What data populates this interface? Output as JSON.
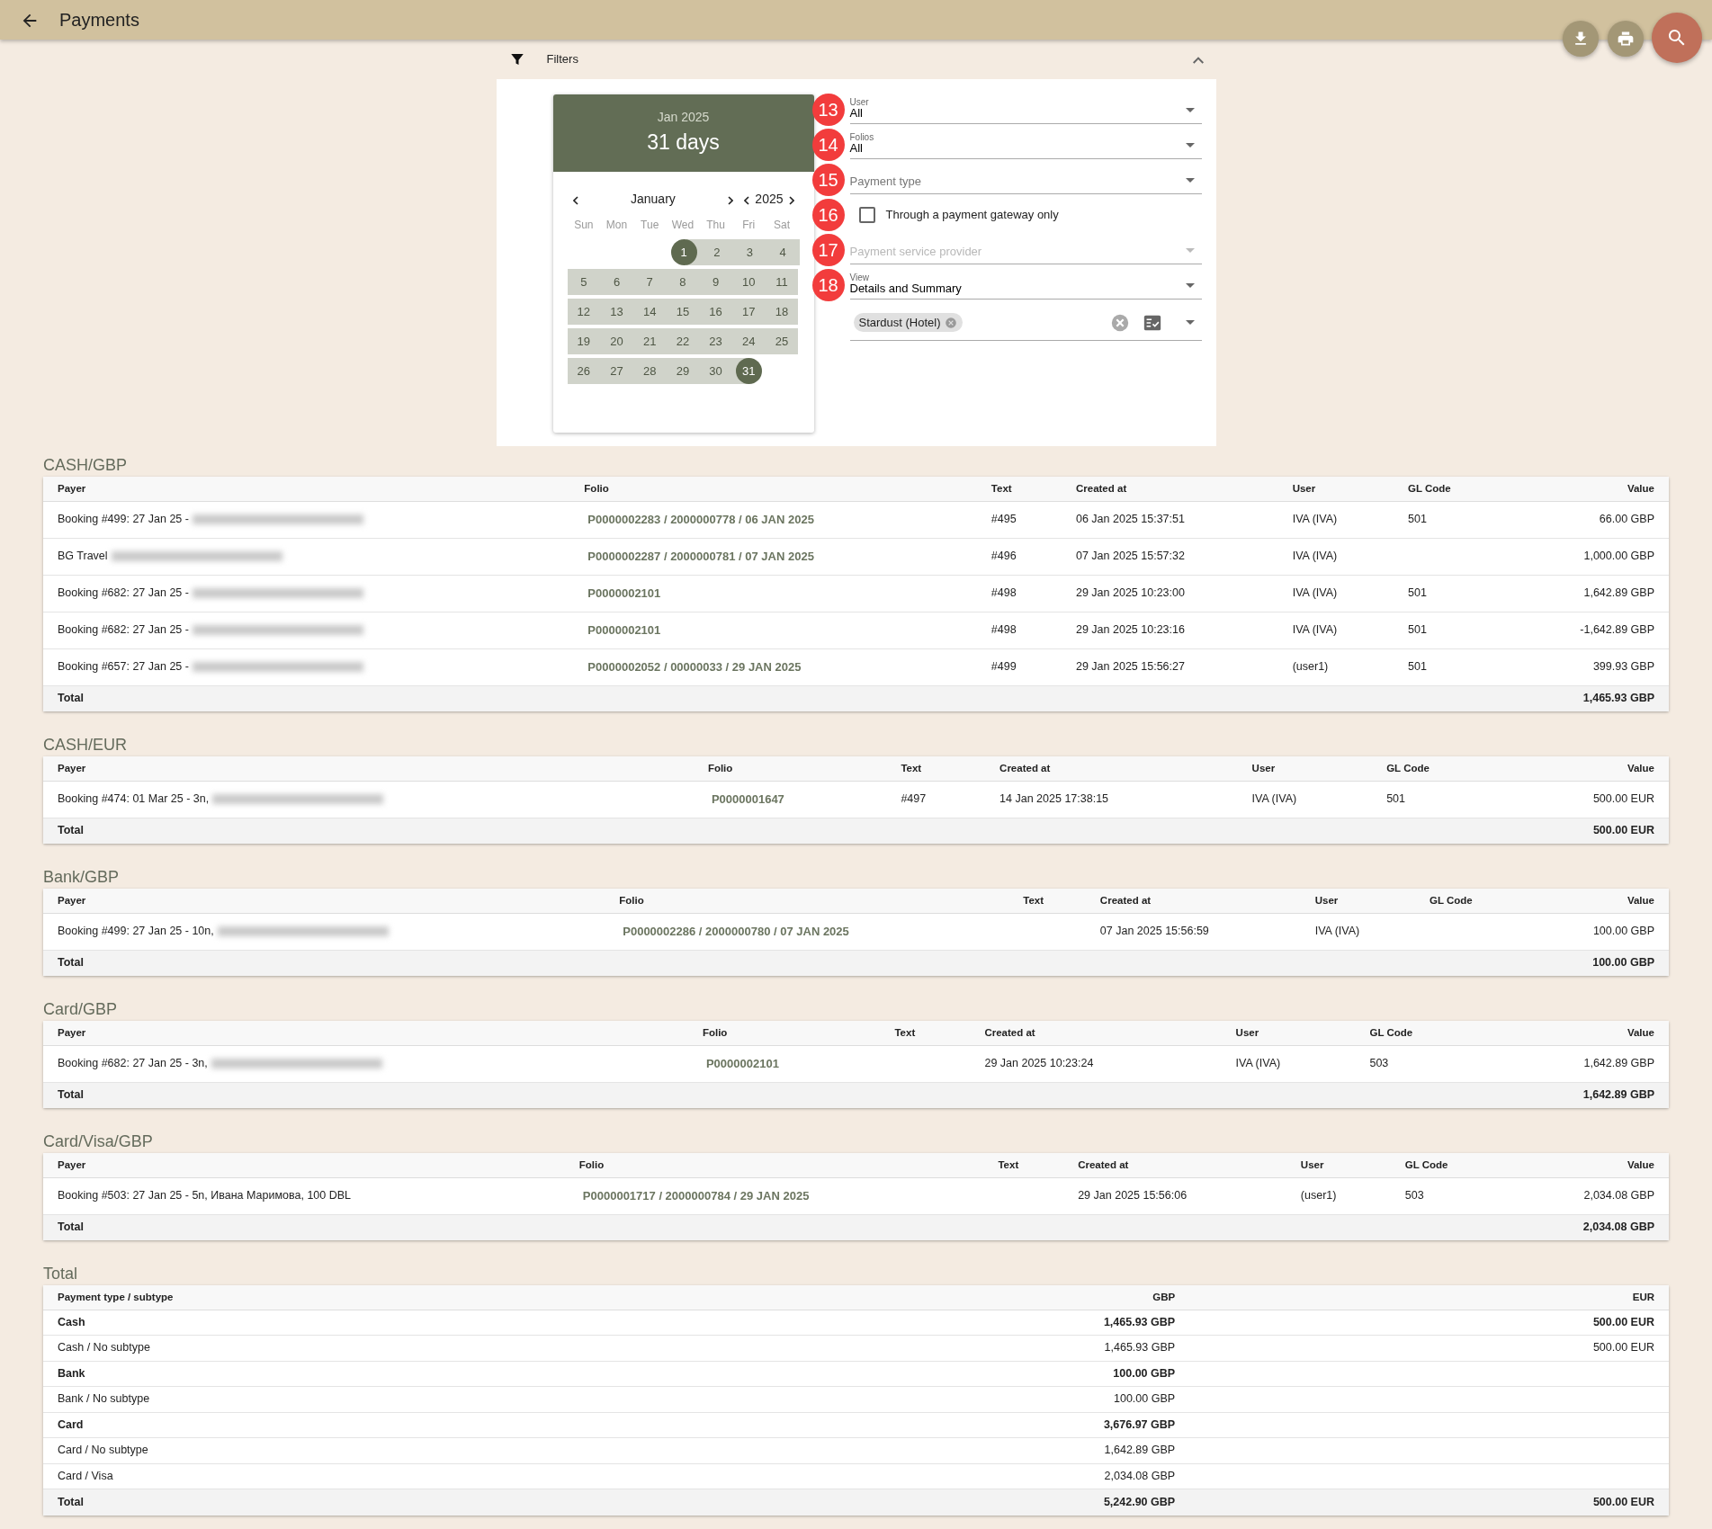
{
  "app_bar": {
    "title": "Payments"
  },
  "filters": {
    "title": "Filters",
    "expanded": true,
    "date_range": {
      "header_month": "Jan 2025",
      "header_days": "31 days",
      "month": "January",
      "year": "2025",
      "weekdays": [
        "Sun",
        "Mon",
        "Tue",
        "Wed",
        "Thu",
        "Fri",
        "Sat"
      ],
      "weeks": [
        [
          {
            "label": "1",
            "in_range": true,
            "selected": true
          },
          {
            "label": "2",
            "in_range": true,
            "selected": false
          },
          {
            "label": "3",
            "in_range": true,
            "selected": false
          },
          {
            "label": "4",
            "in_range": true,
            "selected": false
          }
        ],
        [
          {
            "label": "5",
            "in_range": true,
            "selected": false
          },
          {
            "label": "6",
            "in_range": true,
            "selected": false
          },
          {
            "label": "7",
            "in_range": true,
            "selected": false
          },
          {
            "label": "8",
            "in_range": true,
            "selected": false
          },
          {
            "label": "9",
            "in_range": true,
            "selected": false
          },
          {
            "label": "10",
            "in_range": true,
            "selected": false
          },
          {
            "label": "11",
            "in_range": true,
            "selected": false
          }
        ],
        [
          {
            "label": "12",
            "in_range": true,
            "selected": false
          },
          {
            "label": "13",
            "in_range": true,
            "selected": false
          },
          {
            "label": "14",
            "in_range": true,
            "selected": false
          },
          {
            "label": "15",
            "in_range": true,
            "selected": false
          },
          {
            "label": "16",
            "in_range": true,
            "selected": false
          },
          {
            "label": "17",
            "in_range": true,
            "selected": false
          },
          {
            "label": "18",
            "in_range": true,
            "selected": false
          }
        ],
        [
          {
            "label": "19",
            "in_range": true,
            "selected": false
          },
          {
            "label": "20",
            "in_range": true,
            "selected": false
          },
          {
            "label": "21",
            "in_range": true,
            "selected": false
          },
          {
            "label": "22",
            "in_range": true,
            "selected": false
          },
          {
            "label": "23",
            "in_range": true,
            "selected": false
          },
          {
            "label": "24",
            "in_range": true,
            "selected": false
          },
          {
            "label": "25",
            "in_range": true,
            "selected": false
          }
        ],
        [
          {
            "label": "26",
            "in_range": true,
            "selected": false
          },
          {
            "label": "27",
            "in_range": true,
            "selected": false
          },
          {
            "label": "28",
            "in_range": true,
            "selected": false
          },
          {
            "label": "29",
            "in_range": true,
            "selected": false
          },
          {
            "label": "30",
            "in_range": true,
            "selected": false
          },
          {
            "label": "31",
            "in_range": true,
            "selected": true
          }
        ]
      ]
    },
    "fields": [
      {
        "step": "13",
        "kind": "select",
        "label": "User",
        "value": "All"
      },
      {
        "step": "14",
        "kind": "select",
        "label": "Folios",
        "value": "All"
      },
      {
        "step": "15",
        "kind": "select",
        "placeholder": "Payment type"
      },
      {
        "step": "16",
        "kind": "checkbox",
        "label": "Through a payment gateway only",
        "checked": false
      },
      {
        "step": "17",
        "kind": "select",
        "placeholder": "Payment service provider",
        "disabled": true
      },
      {
        "step": "18",
        "kind": "select",
        "label": "View",
        "value": "Details and Summary"
      },
      {
        "kind": "chips",
        "chips": [
          "Stardust (Hotel)"
        ]
      }
    ]
  },
  "sections": [
    {
      "title": "CASH/GBP",
      "columns": [
        "Payer",
        "Folio",
        "Text",
        "Created at",
        "User",
        "GL Code",
        "Value"
      ],
      "rows": [
        {
          "payer": "Booking #499: 27 Jan 25 -",
          "redacted": true,
          "folio": "P0000002283 / 2000000778 / 06 JAN 2025",
          "text": "#495",
          "created_at": "06 Jan 2025 15:37:51",
          "user": "IVA (IVA)",
          "gl_code": "501",
          "value": "66.00 GBP"
        },
        {
          "payer": "BG Travel",
          "redacted": true,
          "folio": "P0000002287 / 2000000781 / 07 JAN 2025",
          "text": "#496",
          "created_at": "07 Jan 2025 15:57:32",
          "user": "IVA (IVA)",
          "value": "1,000.00 GBP"
        },
        {
          "payer": "Booking #682: 27 Jan 25 -",
          "redacted": true,
          "folio": "P0000002101",
          "text": "#498",
          "created_at": "29 Jan 2025 10:23:00",
          "user": "IVA (IVA)",
          "gl_code": "501",
          "value": "1,642.89 GBP"
        },
        {
          "payer": "Booking #682: 27 Jan 25 -",
          "redacted": true,
          "folio": "P0000002101",
          "text": "#498",
          "created_at": "29 Jan 2025 10:23:16",
          "user": "IVA (IVA)",
          "gl_code": "501",
          "value": "-1,642.89 GBP"
        },
        {
          "payer": "Booking #657: 27 Jan 25 -",
          "redacted": true,
          "folio": "P0000002052 / 00000033 / 29 JAN 2025",
          "text": "#499",
          "created_at": "29 Jan 2025 15:56:27",
          "user": "(user1)",
          "gl_code": "501",
          "value": "399.93 GBP"
        }
      ],
      "total_label": "Total",
      "total": "1,465.93 GBP"
    },
    {
      "title": "CASH/EUR",
      "columns": [
        "Payer",
        "Folio",
        "Text",
        "Created at",
        "User",
        "GL Code",
        "Value"
      ],
      "rows": [
        {
          "payer": "Booking #474: 01 Mar 25 - 3n,",
          "redacted": true,
          "folio": "P0000001647",
          "text": "#497",
          "created_at": "14 Jan 2025 17:38:15",
          "user": "IVA (IVA)",
          "gl_code": "501",
          "value": "500.00 EUR"
        }
      ],
      "total_label": "Total",
      "total": "500.00 EUR"
    },
    {
      "title": "Bank/GBP",
      "columns": [
        "Payer",
        "Folio",
        "Text",
        "Created at",
        "User",
        "GL Code",
        "Value"
      ],
      "rows": [
        {
          "payer": "Booking #499: 27 Jan 25 - 10n,",
          "redacted": true,
          "folio": "P0000002286 / 2000000780 / 07 JAN 2025",
          "created_at": "07 Jan 2025 15:56:59",
          "user": "IVA (IVA)",
          "value": "100.00 GBP"
        }
      ],
      "total_label": "Total",
      "total": "100.00 GBP"
    },
    {
      "title": "Card/GBP",
      "columns": [
        "Payer",
        "Folio",
        "Text",
        "Created at",
        "User",
        "GL Code",
        "Value"
      ],
      "rows": [
        {
          "payer": "Booking #682: 27 Jan 25 - 3n,",
          "redacted": true,
          "folio": "P0000002101",
          "created_at": "29 Jan 2025 10:23:24",
          "user": "IVA (IVA)",
          "gl_code": "503",
          "value": "1,642.89 GBP"
        }
      ],
      "total_label": "Total",
      "total": "1,642.89 GBP"
    },
    {
      "title": "Card/Visa/GBP",
      "columns": [
        "Payer",
        "Folio",
        "Text",
        "Created at",
        "User",
        "GL Code",
        "Value"
      ],
      "rows": [
        {
          "payer": "Booking #503: 27 Jan 25 - 5n, Ивана Маримова, 100 DBL",
          "redacted": false,
          "folio": "P0000001717 / 2000000784 / 29 JAN 2025",
          "created_at": "29 Jan 2025 15:56:06",
          "user": "(user1)",
          "gl_code": "503",
          "value": "2,034.08 GBP"
        }
      ],
      "total_label": "Total",
      "total": "2,034.08 GBP"
    }
  ],
  "summary": {
    "title": "Total",
    "columns": [
      "Payment type / subtype",
      "GBP",
      "EUR"
    ],
    "rows": [
      {
        "kind": "group",
        "cells": [
          "Cash",
          "1,465.93 GBP",
          "500.00 EUR"
        ]
      },
      {
        "kind": "item",
        "cells": [
          "Cash / No subtype",
          "1,465.93 GBP",
          "500.00 EUR"
        ]
      },
      {
        "kind": "group",
        "cells": [
          "Bank",
          "100.00 GBP"
        ]
      },
      {
        "kind": "item",
        "cells": [
          "Bank / No subtype",
          "100.00 GBP"
        ]
      },
      {
        "kind": "group",
        "cells": [
          "Card",
          "3,676.97 GBP"
        ]
      },
      {
        "kind": "item",
        "cells": [
          "Card / No subtype",
          "1,642.89 GBP"
        ]
      },
      {
        "kind": "item",
        "cells": [
          "Card / Visa",
          "2,034.08 GBP"
        ]
      },
      {
        "kind": "total",
        "cells": [
          "Total",
          "5,242.90 GBP",
          "500.00 EUR"
        ]
      }
    ]
  }
}
